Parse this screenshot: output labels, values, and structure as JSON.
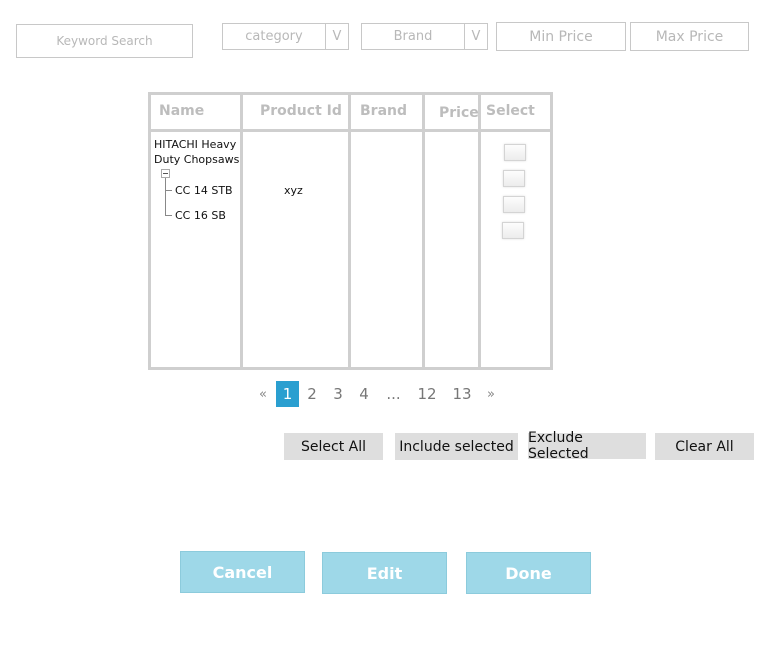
{
  "filters": {
    "keyword_placeholder": "Keyword Search",
    "category_label": "category",
    "brand_label": "Brand",
    "dropdown_arrow": "V",
    "min_price_placeholder": "Min Price",
    "max_price_placeholder": "Max Price"
  },
  "table": {
    "headers": {
      "name": "Name",
      "product_id": "Product Id",
      "brand": "Brand",
      "price": "Price",
      "select": "Select"
    },
    "group": {
      "name_line1": "HITACHI Heavy",
      "name_line2": "Duty Chopsaws",
      "tree_toggle_icon": "minus-box-icon"
    },
    "rows": [
      {
        "name": "CC 14 STB",
        "product_id": "xyz"
      },
      {
        "name": "CC 16 SB",
        "product_id": ""
      }
    ],
    "checkbox_count": 4
  },
  "pagination": {
    "prev": "«",
    "pages": [
      "1",
      "2",
      "3",
      "4",
      "...",
      "12",
      "13"
    ],
    "active": "1",
    "next": "»",
    "active_color": "#2a9fd0"
  },
  "selection_actions": {
    "select_all": "Select All",
    "include_selected": "Include selected",
    "exclude_selected": "Exclude Selected",
    "clear_all": "Clear All"
  },
  "footer_actions": {
    "cancel": "Cancel",
    "edit": "Edit",
    "done": "Done",
    "button_color": "#9ed8e8"
  }
}
